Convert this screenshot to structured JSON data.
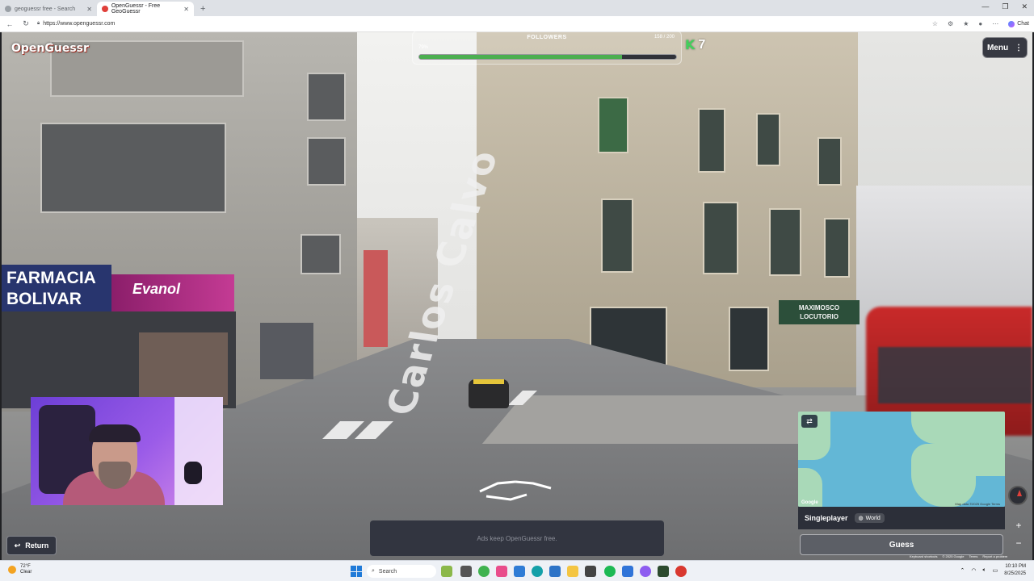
{
  "browser": {
    "tabs": [
      {
        "title": "geoguessr free - Search",
        "active": false
      },
      {
        "title": "OpenGuessr - Free GeoGuessr",
        "active": true
      }
    ],
    "new_tab": "+",
    "url": "https://www.openguessr.com",
    "chat_label": "Chat"
  },
  "game": {
    "logo": "OpenGuessr",
    "followers": {
      "title": "FOLLOWERS",
      "percent_label": "79%",
      "count": "158 / 200",
      "progress": 0.79
    },
    "k_count": "7",
    "menu_label": "Menu",
    "street_name": "Carlos Calvo",
    "shop_signs": {
      "farmacia_line1": "FARMACIA",
      "farmacia_line2": "BOLIVAR",
      "evanol": "Evanol",
      "maximo_line1": "MAXIMOSCO",
      "maximo_line2": "LOCUTORIO"
    },
    "map": {
      "attribution": "Map data ©2025 Google   Terms",
      "google": "Google"
    },
    "mode_label": "Singleplayer",
    "region_label": "World",
    "guess_label": "Guess",
    "ads_text": "Ads keep OpenGuessr free.",
    "return_label": "Return",
    "map_footer": [
      "Keyboard shortcuts",
      "© 2025 Google",
      "Terms",
      "Report a problem"
    ]
  },
  "taskbar": {
    "weather_temp": "72°F",
    "weather_desc": "Clear",
    "search_placeholder": "Search",
    "time": "10:10 PM",
    "date": "8/25/2025"
  },
  "colors": {
    "progress_fill": "#4caf50",
    "k_icon": "#41d15b",
    "bus": "#c92a2a"
  }
}
